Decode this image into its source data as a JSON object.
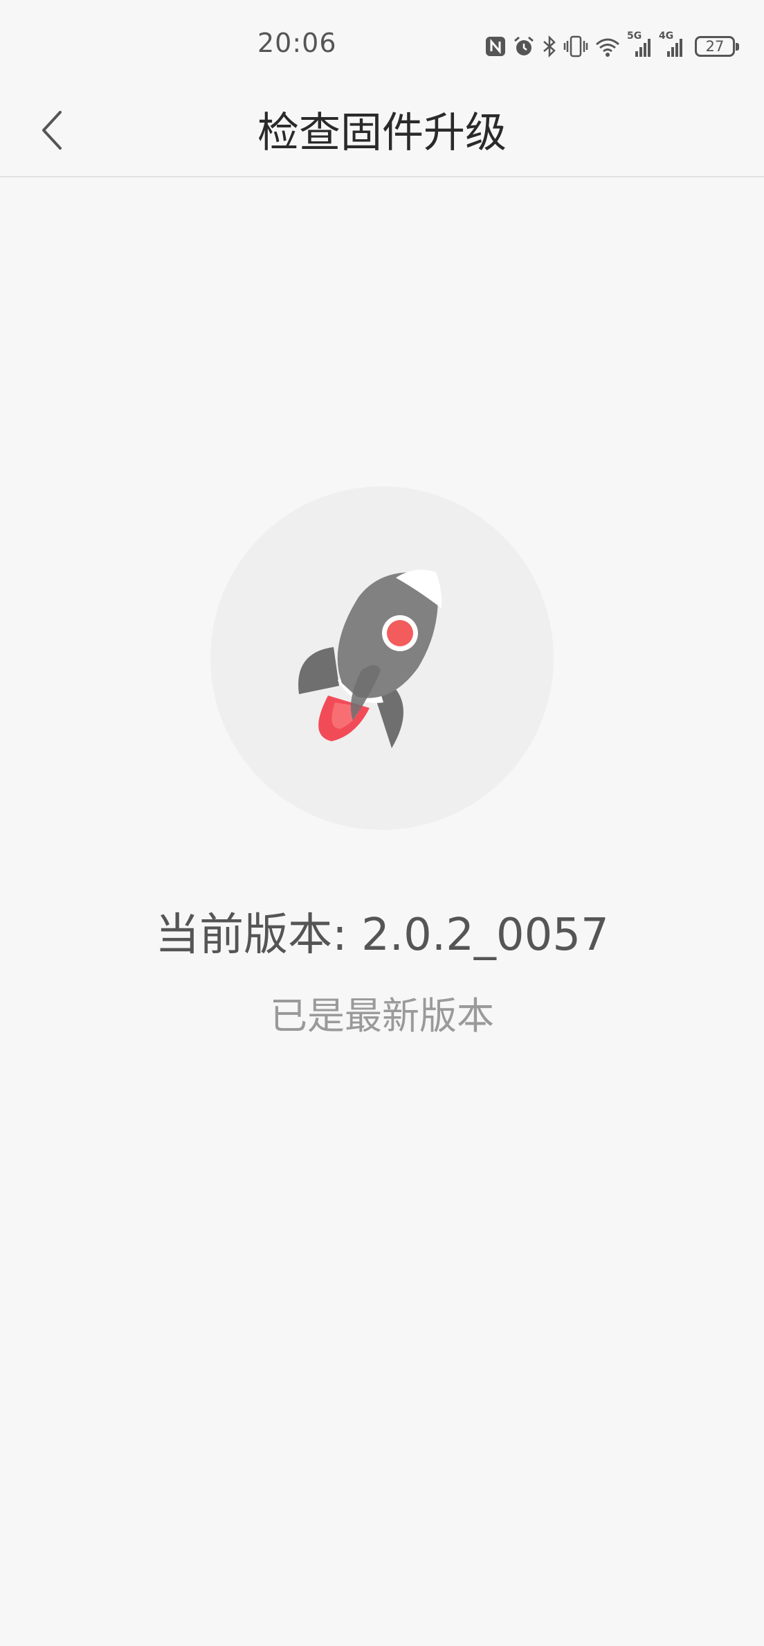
{
  "status_bar": {
    "time": "20:06",
    "battery_level": "27",
    "icons": [
      "nfc-icon",
      "alarm-icon",
      "bluetooth-icon",
      "vibrate-icon",
      "wifi-icon",
      "signal-5g-icon",
      "signal-4g-icon",
      "battery-icon"
    ],
    "network_5g": "5G",
    "network_4g": "4G"
  },
  "header": {
    "title": "检查固件升级",
    "back_icon": "chevron-left-icon"
  },
  "main": {
    "illustration": "rocket-icon",
    "version_text": "当前版本: 2.0.2_0057",
    "status_text": "已是最新版本"
  },
  "colors": {
    "background": "#f7f7f7",
    "circle": "#efefef",
    "rocket_body": "#7d7d7d",
    "rocket_window": "#f25c5c",
    "flame": "#f24b58"
  }
}
